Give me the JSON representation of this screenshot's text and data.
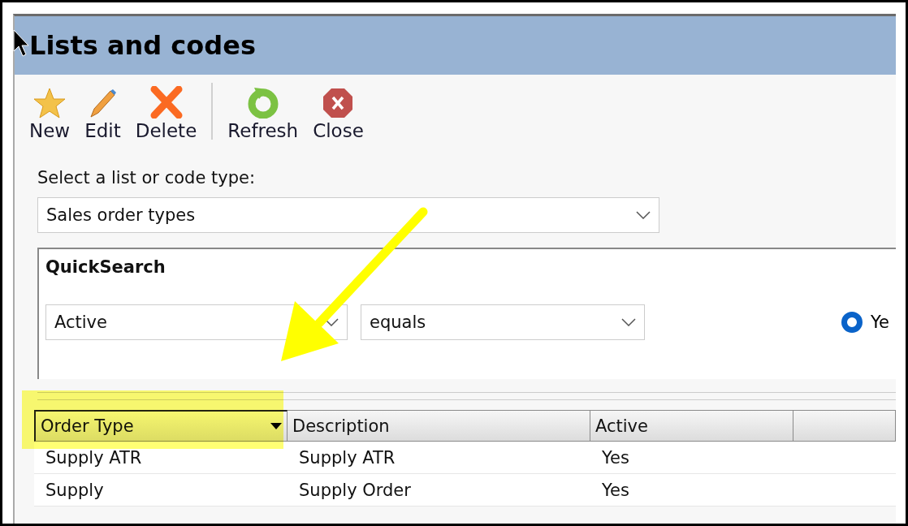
{
  "window": {
    "title": "Lists and codes"
  },
  "toolbar_groups": [
    [
      {
        "label": "New"
      },
      {
        "label": "Edit"
      },
      {
        "label": "Delete"
      }
    ],
    [
      {
        "label": "Refresh"
      },
      {
        "label": "Close"
      }
    ]
  ],
  "list_type": {
    "label": "Select a list or code type:",
    "value": "Sales order types"
  },
  "quick_search": {
    "title": "QuickSearch",
    "field": "Active",
    "operator": "equals",
    "options": [
      {
        "label": "Ye",
        "selected": true
      }
    ]
  },
  "table": {
    "columns": [
      {
        "label": "Order Type",
        "sorted": true
      },
      {
        "label": "Description",
        "sorted": false
      },
      {
        "label": "Active",
        "sorted": false
      },
      {
        "sorted": false
      }
    ],
    "rows": [
      [
        "Supply ATR",
        "Supply ATR",
        "Yes"
      ],
      [
        "Supply",
        "Supply Order",
        "Yes"
      ]
    ]
  }
}
